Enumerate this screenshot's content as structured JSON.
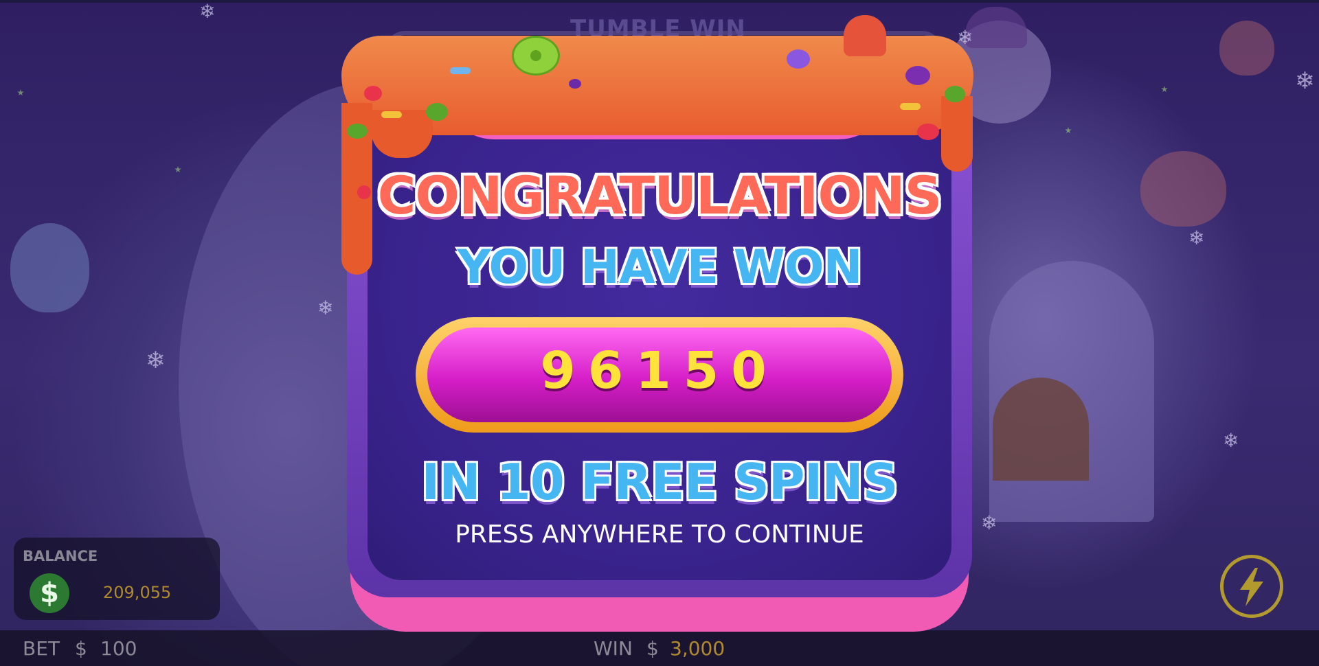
{
  "background": {
    "header_label": "TUMBLE WIN"
  },
  "popup": {
    "heading": "CONGRATULATIONS",
    "subheading": "YOU HAVE WON",
    "amount": "96150",
    "spins_text": "IN 10 FREE SPINS",
    "instruction": "PRESS ANYWHERE TO CONTINUE"
  },
  "hud": {
    "balance_label": "BALANCE",
    "balance_icon": "$",
    "balance_value": "209,055",
    "bet_label": "BET",
    "bet_currency": "$",
    "bet_value": "100",
    "win_label": "WIN",
    "win_currency": "$",
    "win_value": "3,000",
    "turbo_icon": "lightning-icon"
  },
  "colors": {
    "heading": "#ff6a58",
    "subheading": "#45b6f2",
    "amount_text": "#ffe23a",
    "amount_pill": "#d51ec7",
    "popup_body": "#38228a",
    "icing": "#e85c2f"
  }
}
